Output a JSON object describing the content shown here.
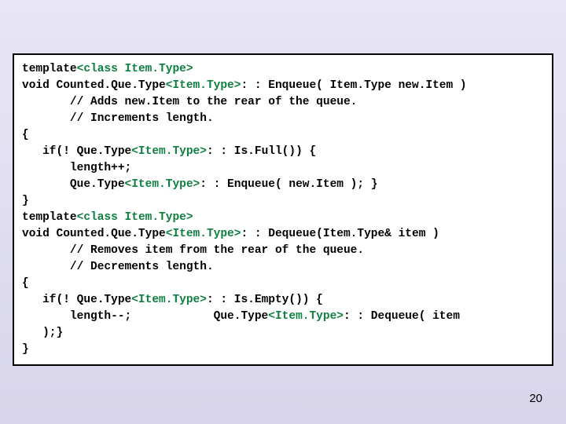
{
  "code": {
    "lines": [
      {
        "segments": [
          {
            "t": "template"
          },
          {
            "t": "<class Item.Type>",
            "cls": "tparam"
          }
        ]
      },
      {
        "segments": [
          {
            "t": "void Counted.Que.Type"
          },
          {
            "t": "<Item.Type>",
            "cls": "tparam"
          },
          {
            "t": ": : Enqueue( Item.Type new.Item )"
          }
        ]
      },
      {
        "segments": [
          {
            "t": "       // Adds new.Item to the rear of the queue."
          }
        ]
      },
      {
        "segments": [
          {
            "t": "       // Increments length."
          }
        ]
      },
      {
        "segments": [
          {
            "t": "{"
          }
        ]
      },
      {
        "segments": [
          {
            "t": "   if(! Que.Type"
          },
          {
            "t": "<Item.Type>",
            "cls": "tparam"
          },
          {
            "t": ": : Is.Full()) {"
          }
        ]
      },
      {
        "segments": [
          {
            "t": "       length++;"
          }
        ]
      },
      {
        "segments": [
          {
            "t": "       Que.Type"
          },
          {
            "t": "<Item.Type>",
            "cls": "tparam"
          },
          {
            "t": ": : Enqueue( new.Item ); }"
          }
        ]
      },
      {
        "segments": [
          {
            "t": "}"
          }
        ]
      },
      {
        "segments": [
          {
            "t": "template"
          },
          {
            "t": "<class Item.Type>",
            "cls": "tparam"
          }
        ]
      },
      {
        "segments": [
          {
            "t": "void Counted.Que.Type"
          },
          {
            "t": "<Item.Type>",
            "cls": "tparam"
          },
          {
            "t": ": : Dequeue(Item.Type& item )"
          }
        ]
      },
      {
        "segments": [
          {
            "t": "       // Removes item from the rear of the queue."
          }
        ]
      },
      {
        "segments": [
          {
            "t": "       // Decrements length."
          }
        ]
      },
      {
        "segments": [
          {
            "t": "{"
          }
        ]
      },
      {
        "segments": [
          {
            "t": "   if(! Que.Type"
          },
          {
            "t": "<Item.Type>",
            "cls": "tparam"
          },
          {
            "t": ": : Is.Empty()) {"
          }
        ]
      },
      {
        "segments": [
          {
            "t": "       length--;            Que.Type"
          },
          {
            "t": "<Item.Type>",
            "cls": "tparam"
          },
          {
            "t": ": : Dequeue( item"
          }
        ]
      },
      {
        "segments": [
          {
            "t": "   );}"
          }
        ]
      },
      {
        "segments": [
          {
            "t": "}"
          }
        ]
      }
    ]
  },
  "pageNumber": "20"
}
